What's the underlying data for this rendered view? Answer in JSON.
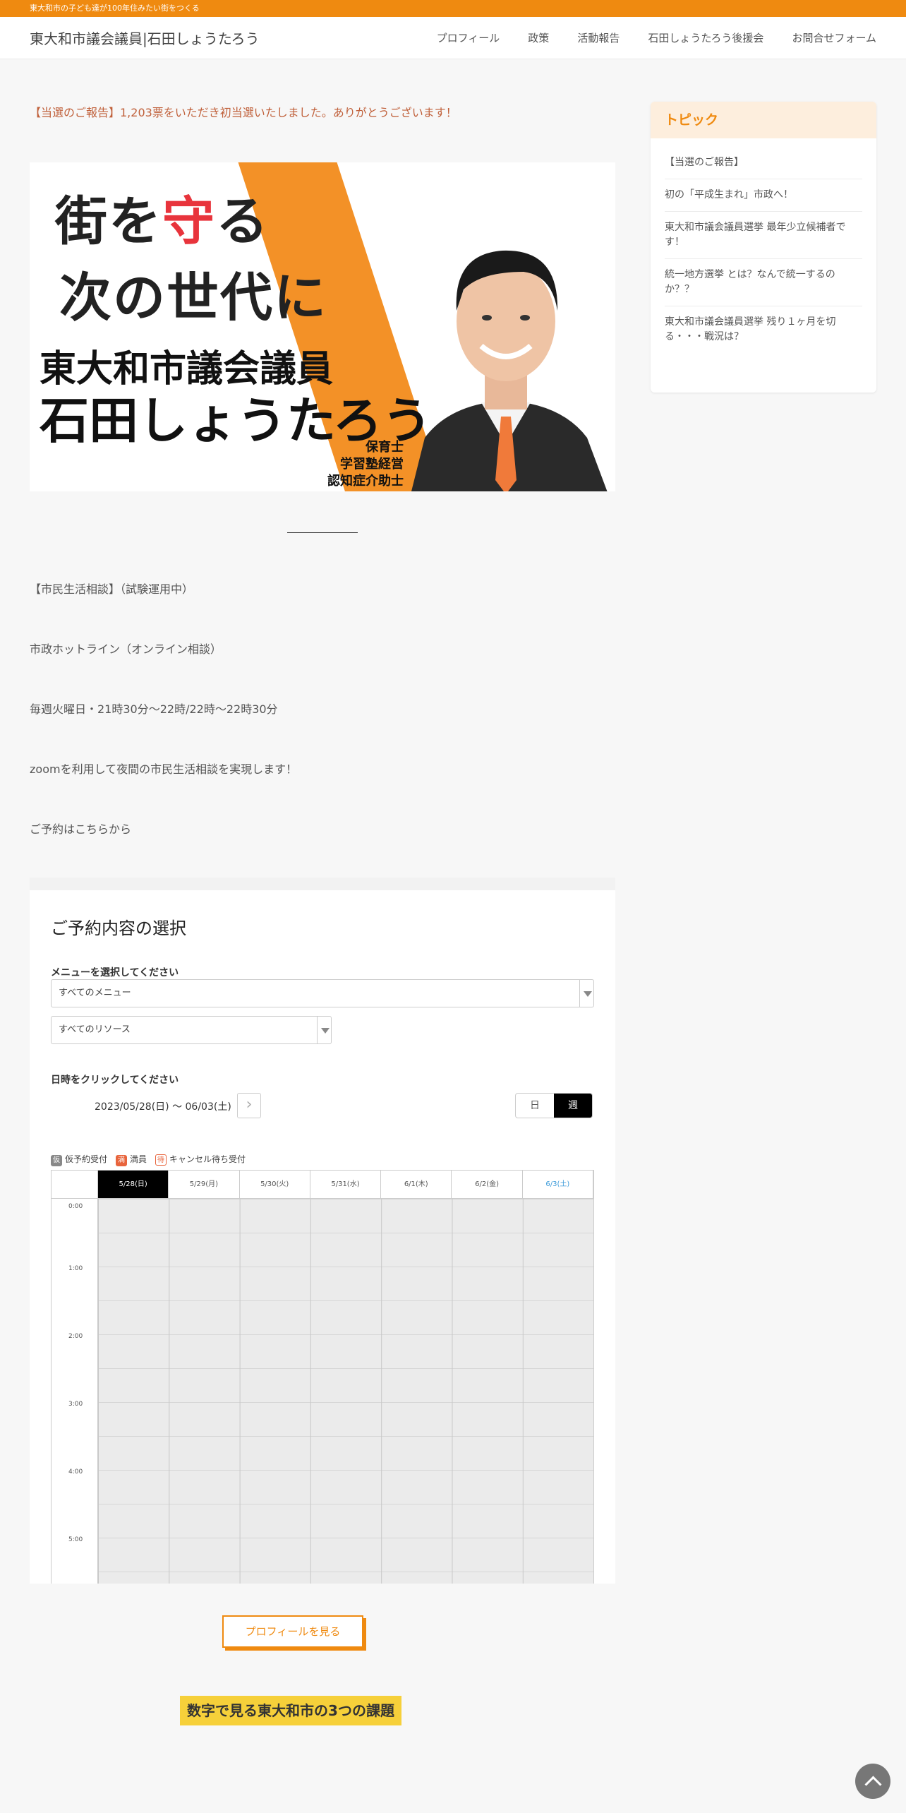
{
  "topbar": {
    "tagline": "東大和市の子ども達が100年住みたい街をつくる"
  },
  "header": {
    "site_title": "東大和市議会議員|石田しょうたろう",
    "nav": [
      "プロフィール",
      "政策",
      "活動報告",
      "石田しょうたろう後援会",
      "お問合せフォーム"
    ]
  },
  "main": {
    "notice": "【当選のご報告】1,203票をいただき初当選いたしました。ありがとうございます！",
    "hero": {
      "line1_a": "街を",
      "line1_red": "守",
      "line1_b": "る",
      "line2": "次の世代に",
      "line3": "東大和市議会議員",
      "line4": "石田しょうたろう",
      "roles": [
        "保育士",
        "学習塾経営",
        "認知症介助士"
      ]
    },
    "paragraphs": [
      "【市民生活相談】（試験運用中）",
      "市政ホットライン（オンライン相談）",
      "毎週火曜日・21時30分〜22時/22時〜22時30分",
      "zoomを利用して夜間の市民生活相談を実現します！",
      "ご予約はこちらから"
    ],
    "profile_button": "プロフィールを見る",
    "section_title": "数字で見る東大和市の3つの課題"
  },
  "booking": {
    "title": "ご予約内容の選択",
    "menu_label": "メニューを選択してください",
    "menu_value": "すべてのメニュー",
    "resource_value": "すべてのリソース",
    "date_label": "日時をクリックしてください",
    "range": "2023/05/28(日) 〜 06/03(土)",
    "next_glyph": "›",
    "view_day": "日",
    "view_week": "週",
    "legend": [
      {
        "badge": "仮",
        "text": "仮予約受付",
        "color": "#888888"
      },
      {
        "badge": "満",
        "text": "満員",
        "color": "#e8643c"
      },
      {
        "badge": "待",
        "text": "キャンセル待ち受付",
        "color": "#e8643c"
      }
    ],
    "days": [
      "5/28(日)",
      "5/29(月)",
      "5/30(火)",
      "5/31(水)",
      "6/1(木)",
      "6/2(金)",
      "6/3(土)"
    ],
    "times": [
      "0:00",
      "1:00",
      "2:00",
      "3:00",
      "4:00",
      "5:00"
    ]
  },
  "sidebar": {
    "heading": "トピック",
    "items": [
      "【当選のご報告】",
      "初の「平成生まれ」市政へ！",
      "東大和市議会議員選挙 最年少立候補者です！",
      "統一地方選挙 とは？なんで統一するのか？？",
      "東大和市議会議員選挙 残り１ヶ月を切る・・・戦況は？"
    ]
  },
  "colors": {
    "accent": "#ef8a10",
    "highlight": "#f6d03a",
    "hero_stripe": "#f39127",
    "red": "#e8343c"
  }
}
